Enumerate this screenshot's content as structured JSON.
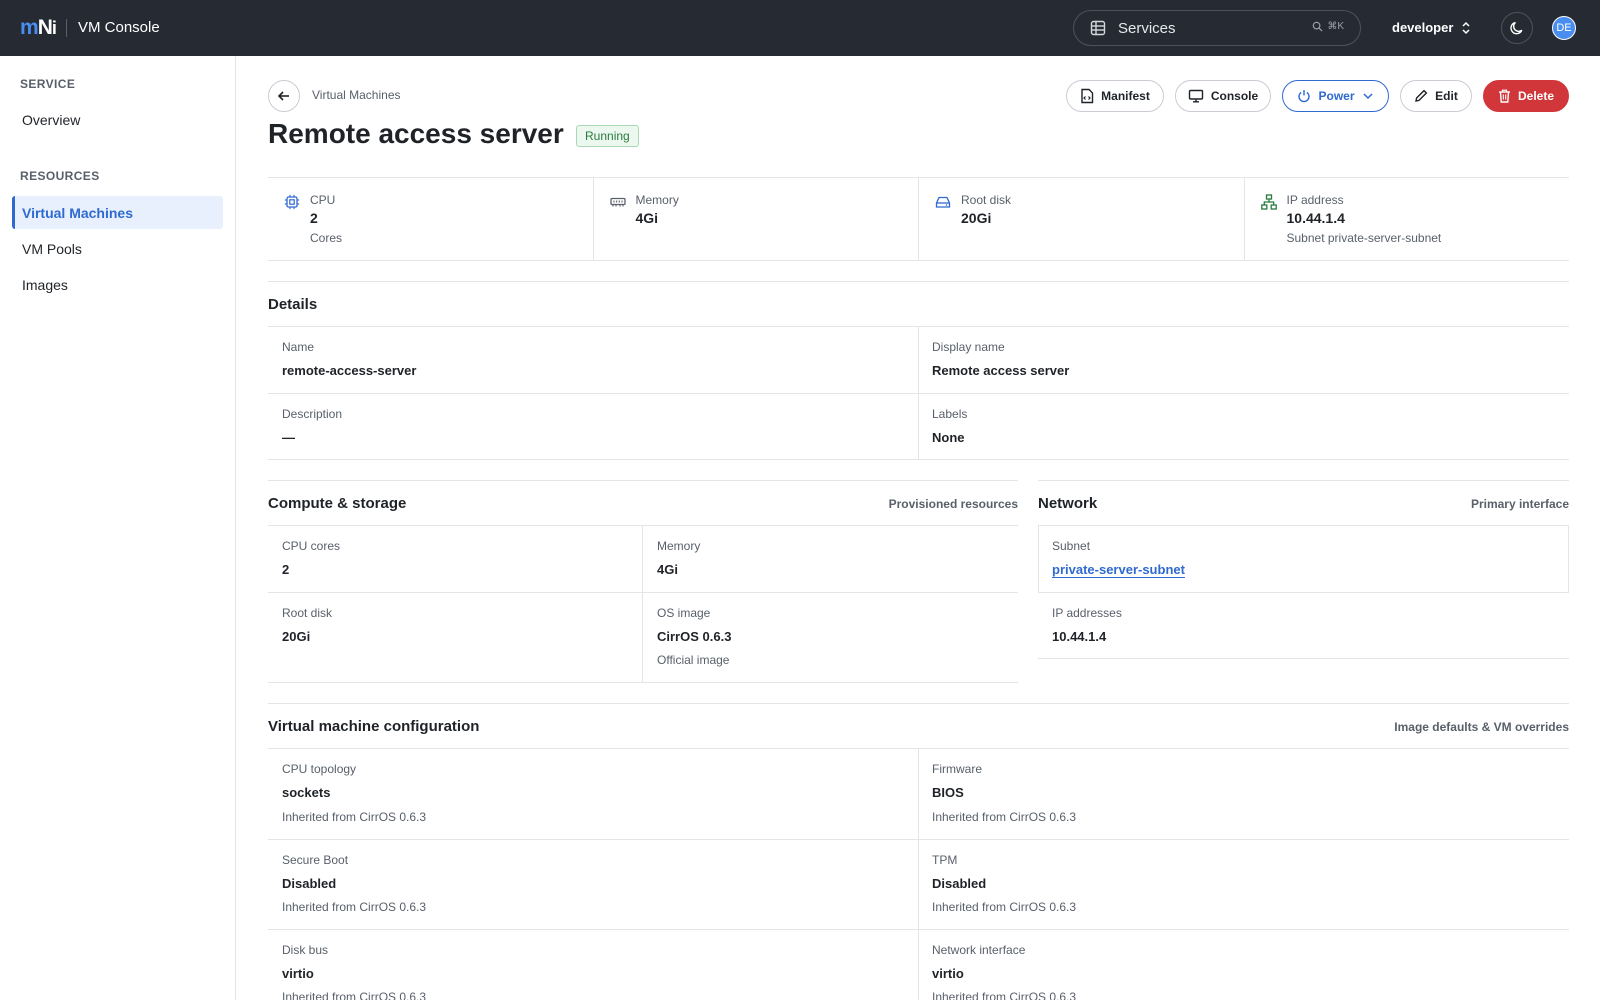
{
  "header": {
    "app_title": "VM Console",
    "services_label": "Services",
    "shortcut": "⌘K",
    "namespace": "developer",
    "avatar_initials": "DE"
  },
  "sidebar": {
    "service_heading": "SERVICE",
    "service_items": [
      "Overview"
    ],
    "resources_heading": "RESOURCES",
    "resource_items": [
      "Virtual Machines",
      "VM Pools",
      "Images"
    ],
    "active_item": "Virtual Machines"
  },
  "page": {
    "breadcrumb": "Virtual Machines",
    "title": "Remote access server",
    "status": "Running",
    "actions": {
      "manifest": "Manifest",
      "console": "Console",
      "power": "Power",
      "edit": "Edit",
      "delete": "Delete"
    }
  },
  "stats": [
    {
      "label": "CPU",
      "value": "2",
      "sub": "Cores",
      "icon": "cpu-icon"
    },
    {
      "label": "Memory",
      "value": "4Gi",
      "sub": "",
      "icon": "memory-icon"
    },
    {
      "label": "Root disk",
      "value": "20Gi",
      "sub": "",
      "icon": "disk-icon"
    },
    {
      "label": "IP address",
      "value": "10.44.1.4",
      "sub": "Subnet private-server-subnet",
      "icon": "network-icon"
    }
  ],
  "details": {
    "title": "Details",
    "name_label": "Name",
    "name_value": "remote-access-server",
    "display_name_label": "Display name",
    "display_name_value": "Remote access server",
    "description_label": "Description",
    "description_value": "—",
    "labels_label": "Labels",
    "labels_value": "None"
  },
  "compute": {
    "title": "Compute & storage",
    "aside": "Provisioned resources",
    "cpu_label": "CPU cores",
    "cpu_value": "2",
    "memory_label": "Memory",
    "memory_value": "4Gi",
    "disk_label": "Root disk",
    "disk_value": "20Gi",
    "os_label": "OS image",
    "os_value": "CirrOS 0.6.3",
    "os_sub": "Official image"
  },
  "network": {
    "title": "Network",
    "aside": "Primary interface",
    "subnet_label": "Subnet",
    "subnet_value": "private-server-subnet",
    "ip_label": "IP addresses",
    "ip_value": "10.44.1.4"
  },
  "config": {
    "title": "Virtual machine configuration",
    "aside": "Image defaults & VM overrides",
    "cpu_topology_label": "CPU topology",
    "cpu_topology_value": "sockets",
    "cpu_topology_sub": "Inherited from CirrOS 0.6.3",
    "firmware_label": "Firmware",
    "firmware_value": "BIOS",
    "firmware_sub": "Inherited from CirrOS 0.6.3",
    "secure_boot_label": "Secure Boot",
    "secure_boot_value": "Disabled",
    "secure_boot_sub": "Inherited from CirrOS 0.6.3",
    "tpm_label": "TPM",
    "tpm_value": "Disabled",
    "tpm_sub": "Inherited from CirrOS 0.6.3",
    "disk_bus_label": "Disk bus",
    "disk_bus_value": "virtio",
    "disk_bus_sub": "Inherited from CirrOS 0.6.3",
    "nic_label": "Network interface",
    "nic_value": "virtio",
    "nic_sub": "Inherited from CirrOS 0.6.3"
  },
  "colors": {
    "topbar": "#262b33",
    "accent": "#2f6ad0",
    "danger": "#d1373a",
    "success": "#2b7a3d"
  }
}
